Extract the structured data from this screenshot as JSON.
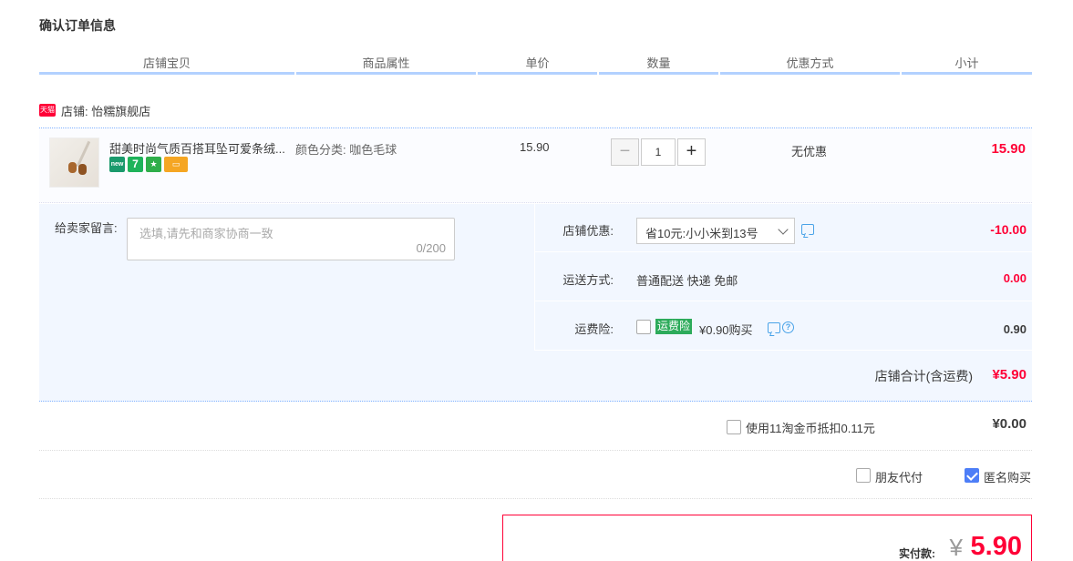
{
  "page_title": "确认订单信息",
  "columns": [
    "店铺宝贝",
    "商品属性",
    "单价",
    "数量",
    "优惠方式",
    "小计"
  ],
  "shop": {
    "badge": "天猫",
    "label": "店铺: 怡糯旗舰店"
  },
  "item": {
    "title": "甜美时尚气质百搭耳坠可爱条绒...",
    "attribute": "颜色分类: 咖色毛球",
    "unit_price": "15.90",
    "quantity": "1",
    "minus": "−",
    "plus": "+",
    "discount": "无优惠",
    "subtotal": "15.90",
    "icons": [
      "new",
      "7",
      "★",
      "▭"
    ]
  },
  "message": {
    "label": "给卖家留言:",
    "placeholder": "选填,请先和商家协商一致",
    "count": "0/200"
  },
  "shop_discount": {
    "label": "店铺优惠:",
    "selected": "省10元:小小米到13号",
    "value": "-10.00"
  },
  "shipping": {
    "label": "运送方式:",
    "method": "普通配送 快递 免邮",
    "value": "0.00"
  },
  "insurance": {
    "label": "运费险:",
    "tag": "运费险",
    "text": "¥0.90购买",
    "value": "0.90"
  },
  "shop_total": {
    "label": "店铺合计(含运费)",
    "value": "¥5.90"
  },
  "coins": {
    "text": "使用11淘金币抵扣0.11元",
    "value": "¥0.00"
  },
  "options": {
    "friend_pay": "朋友代付",
    "anonymous": "匿名购买"
  },
  "payment": {
    "label": "实付款:",
    "yen": "¥",
    "value": "5.90"
  },
  "colors": {
    "accent": "#ff0036",
    "header_line": "#b2d1ff",
    "panel_bg": "#f2f7ff",
    "check_blue": "#4d7ef7",
    "insurance_green": "#2dab5b"
  }
}
